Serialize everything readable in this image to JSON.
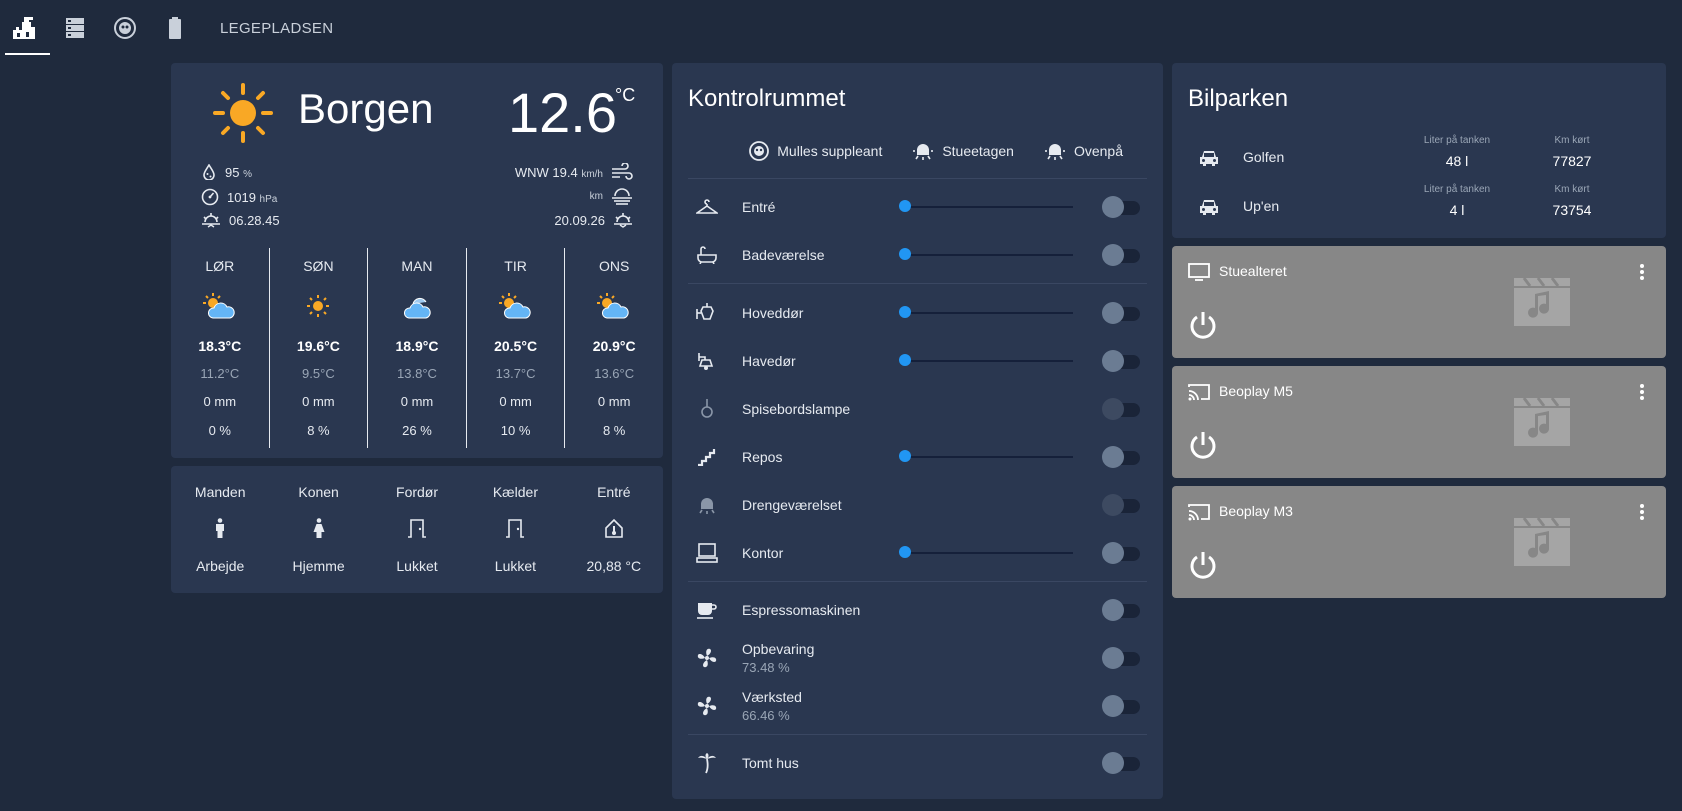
{
  "topbar": {
    "tabs": [
      {
        "icon": "castle-icon",
        "active": true
      },
      {
        "icon": "server-icon",
        "active": false
      },
      {
        "icon": "robot-vacuum-icon",
        "active": false
      },
      {
        "icon": "battery-icon",
        "active": false
      }
    ],
    "label": "LEGEPLADSEN"
  },
  "weather": {
    "city": "Borgen",
    "temperature": "12.6",
    "unit": "°C",
    "humidity": "95",
    "humidity_unit": "%",
    "pressure": "1019",
    "pressure_unit": "hPa",
    "sunrise": "06.28.45",
    "wind": "WNW 19.4",
    "wind_unit": "km/h",
    "visibility_unit": "km",
    "sunset": "20.09.26",
    "forecast": [
      {
        "day": "LØR",
        "icon": "partly-cloudy-icon",
        "high": "18.3°C",
        "low": "11.2°C",
        "precip": "0 mm",
        "chance": "0 %"
      },
      {
        "day": "SØN",
        "icon": "sunny-icon",
        "high": "19.6°C",
        "low": "9.5°C",
        "precip": "0 mm",
        "chance": "8 %"
      },
      {
        "day": "MAN",
        "icon": "cloudy-icon",
        "high": "18.9°C",
        "low": "13.8°C",
        "precip": "0 mm",
        "chance": "26 %"
      },
      {
        "day": "TIR",
        "icon": "partly-cloudy-icon",
        "high": "20.5°C",
        "low": "13.7°C",
        "precip": "0 mm",
        "chance": "10 %"
      },
      {
        "day": "ONS",
        "icon": "partly-cloudy-icon",
        "high": "20.9°C",
        "low": "13.6°C",
        "precip": "0 mm",
        "chance": "8 %"
      }
    ]
  },
  "glance": [
    {
      "name": "Manden",
      "icon": "man-icon",
      "state": "Arbejde"
    },
    {
      "name": "Konen",
      "icon": "woman-icon",
      "state": "Hjemme"
    },
    {
      "name": "Fordør",
      "icon": "door-icon",
      "state": "Lukket"
    },
    {
      "name": "Kælder",
      "icon": "door-icon",
      "state": "Lukket"
    },
    {
      "name": "Entré",
      "icon": "home-thermometer-icon",
      "state": "20,88 °C"
    }
  ],
  "control": {
    "title": "Kontrolrummet",
    "header_buttons": [
      {
        "icon": "robot-vacuum-icon",
        "label": "Mulles suppleant"
      },
      {
        "icon": "ceiling-light-icon",
        "label": "Stueetagen"
      },
      {
        "icon": "ceiling-light-icon",
        "label": "Ovenpå"
      }
    ],
    "rows": [
      {
        "icon": "hanger-icon",
        "name": "Entré",
        "slider": true
      },
      {
        "icon": "bathtub-icon",
        "name": "Badeværelse",
        "slider": true
      },
      {
        "icon": "outdoor-lamp-icon",
        "name": "Hoveddør",
        "slider": true
      },
      {
        "icon": "wall-lamp-icon",
        "name": "Havedør",
        "slider": true
      },
      {
        "icon": "pendant-lamp-icon",
        "name": "Spisebordslampe",
        "slider": false,
        "disabled": true
      },
      {
        "icon": "stairs-icon",
        "name": "Repos",
        "slider": true
      },
      {
        "icon": "ceiling-light-icon",
        "name": "Drengeværelset",
        "slider": false,
        "disabled": true
      },
      {
        "icon": "desktop-icon",
        "name": "Kontor",
        "slider": true
      },
      {
        "icon": "coffee-icon",
        "name": "Espressomaskinen"
      },
      {
        "icon": "fan-icon",
        "name": "Opbevaring",
        "sub": "73.48 %"
      },
      {
        "icon": "fan-icon",
        "name": "Værksted",
        "sub": "66.46 %"
      },
      {
        "icon": "palm-tree-icon",
        "name": "Tomt hus"
      }
    ]
  },
  "cars": {
    "title": "Bilparken",
    "fuel_label": "Liter på tanken",
    "km_label": "Km kørt",
    "items": [
      {
        "name": "Golfen",
        "fuel": "48 l",
        "km": "77827"
      },
      {
        "name": "Up'en",
        "fuel": "4 l",
        "km": "73754"
      }
    ]
  },
  "media": [
    {
      "icon": "tv-icon",
      "name": "Stuealteret"
    },
    {
      "icon": "cast-icon",
      "name": "Beoplay M5"
    },
    {
      "icon": "cast-icon",
      "name": "Beoplay M3"
    }
  ]
}
